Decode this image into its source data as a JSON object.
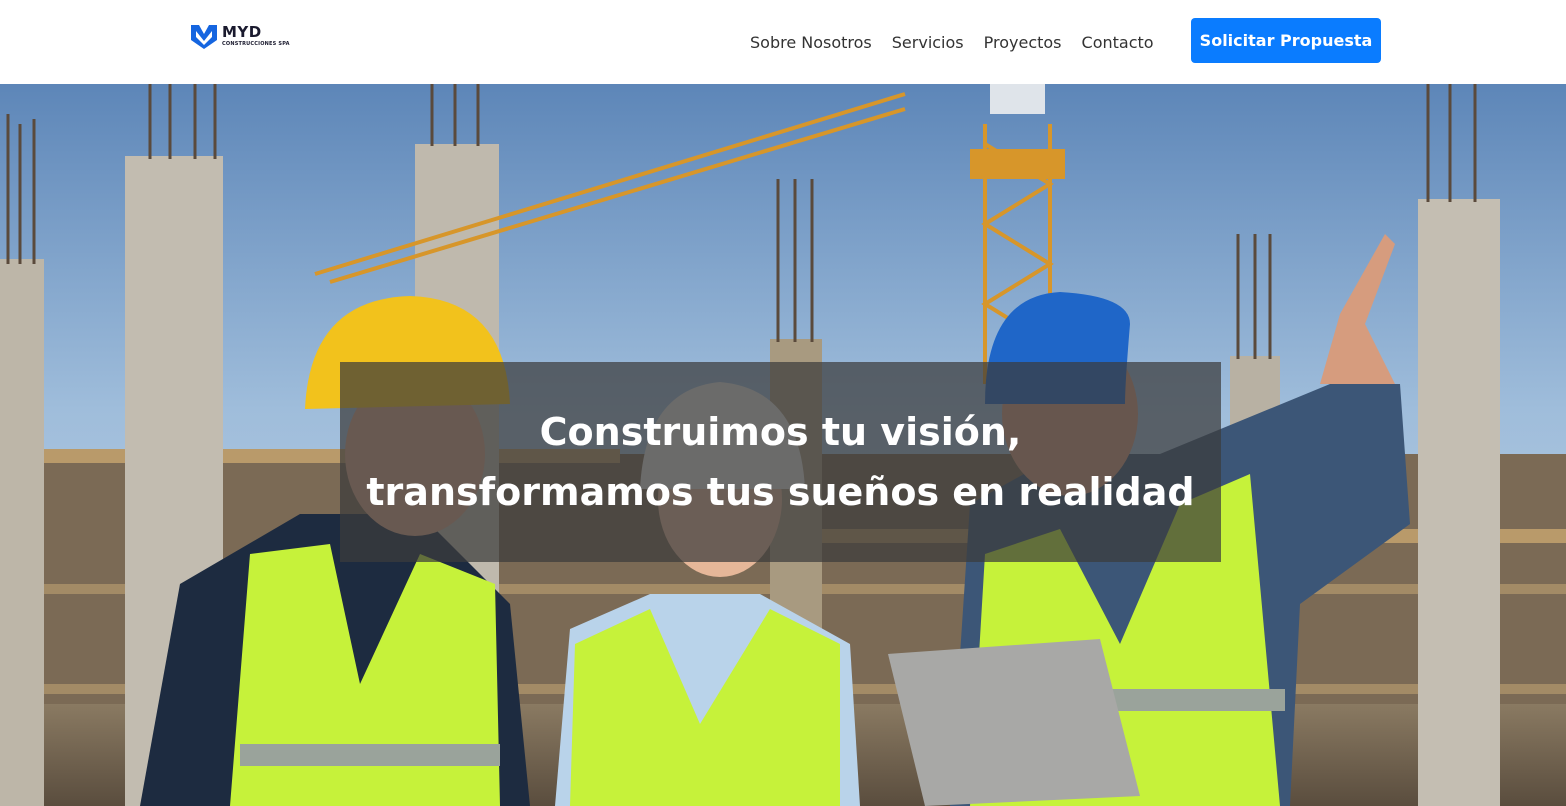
{
  "brand": {
    "name": "MYD",
    "subtitle": "CONSTRUCCIONES SPA",
    "logo_color": "#1565e0",
    "logo_icon": "myd-logo-icon"
  },
  "nav": {
    "links": [
      {
        "label": "Sobre Nosotros"
      },
      {
        "label": "Servicios"
      },
      {
        "label": "Proyectos"
      },
      {
        "label": "Contacto"
      }
    ],
    "cta_label": "Solicitar Propuesta",
    "cta_color": "#0a7cff"
  },
  "hero": {
    "title_line1": "Construimos tu visión,",
    "title_line2": "transformamos tus sueños en realidad",
    "image": "photo-construction-workers-with-hard-hats-and-vests-at-site"
  }
}
